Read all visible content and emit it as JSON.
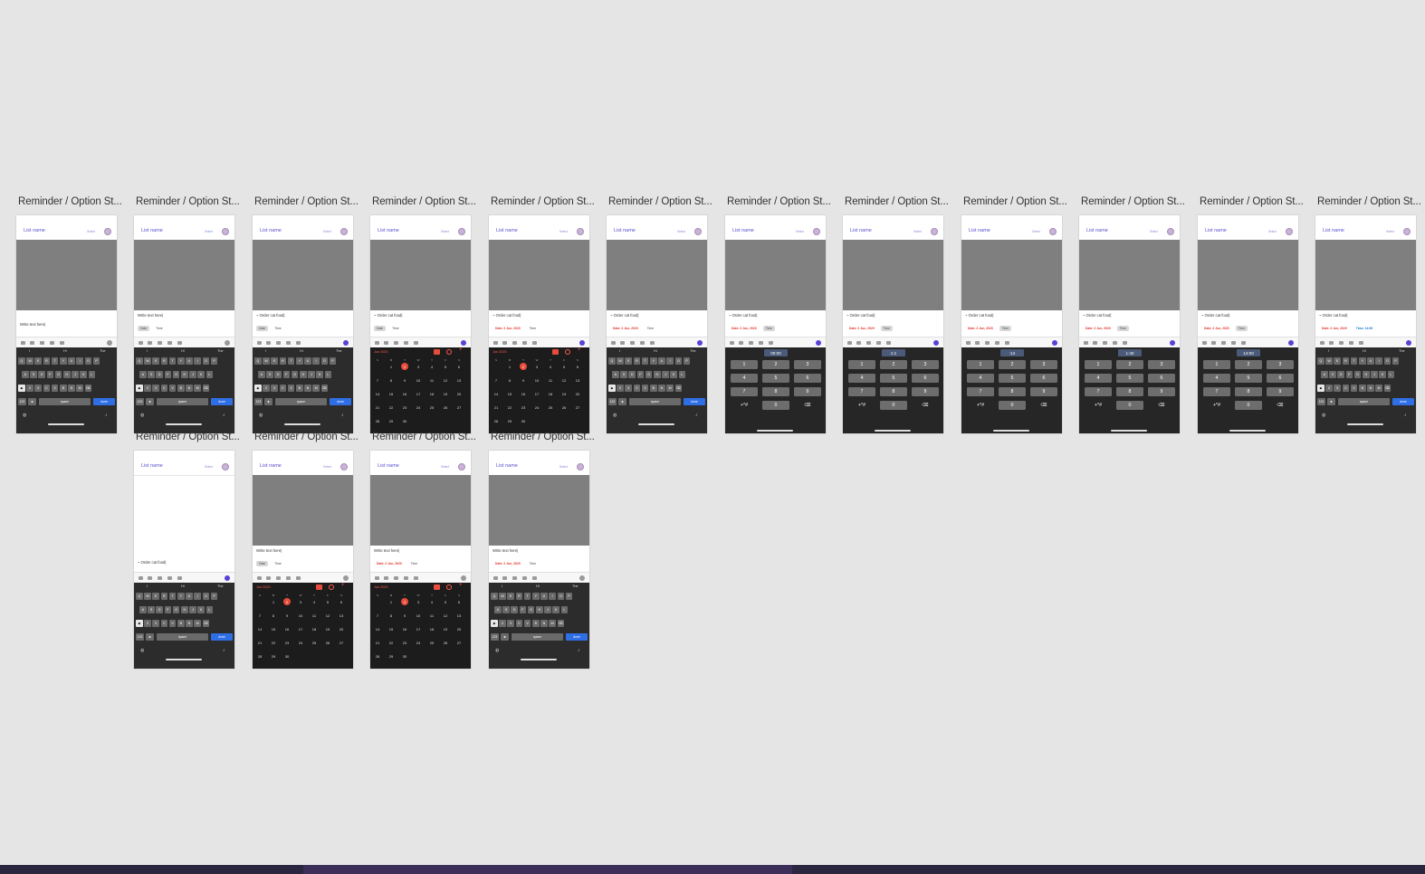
{
  "frames": [
    {
      "title": "Reminder / Option St...",
      "list_name": "List name",
      "select": "Select",
      "task": "Write text here|",
      "date": "",
      "time": "",
      "state": "keyboard",
      "row": 1
    },
    {
      "title": "Reminder / Option St...",
      "list_name": "List name",
      "select": "Select",
      "task": "Write text here|",
      "date": "Date",
      "time": "Time",
      "state": "keyboard",
      "row": 1
    },
    {
      "title": "Reminder / Option St...",
      "list_name": "List name",
      "select": "Select",
      "task": "~ Order cat food|",
      "date": "Date",
      "time": "Time",
      "state": "keyboard",
      "row": 1
    },
    {
      "title": "Reminder / Option St...",
      "list_name": "List name",
      "select": "Select",
      "task": "~ Order cat food|",
      "date": "Date",
      "time": "Time",
      "state": "calendar",
      "row": 1
    },
    {
      "title": "Reminder / Option St...",
      "list_name": "List name",
      "select": "Select",
      "task": "~ Order cat food|",
      "date": "Date: 2 Jun, 2020",
      "time": "Time",
      "state": "calendar",
      "row": 1
    },
    {
      "title": "Reminder / Option St...",
      "list_name": "List name",
      "select": "Select",
      "task": "~ Order cat food|",
      "date": "Date: 2 Jun, 2020",
      "time": "Time",
      "state": "keyboard",
      "row": 1
    },
    {
      "title": "Reminder / Option St...",
      "list_name": "List name",
      "select": "Select",
      "task": "~ Order cat food|",
      "date": "Date: 2 Jun, 2020",
      "time": "Time",
      "state": "numpad",
      "display": "00:00",
      "row": 1
    },
    {
      "title": "Reminder / Option St...",
      "list_name": "List name",
      "select": "Select",
      "task": "~ Order cat food|",
      "date": "Date: 2 Jun, 2020",
      "time": "Time",
      "state": "numpad",
      "display": "1:1",
      "row": 1
    },
    {
      "title": "Reminder / Option St...",
      "list_name": "List name",
      "select": "Select",
      "task": "~ Order cat food|",
      "date": "Date: 2 Jun, 2020",
      "time": "Time",
      "state": "numpad",
      "display": ":14",
      "row": 1
    },
    {
      "title": "Reminder / Option St...",
      "list_name": "List name",
      "select": "Select",
      "task": "~ Order cat food|",
      "date": "Date: 2 Jun, 2020",
      "time": "Time",
      "state": "numpad",
      "display": "1:40",
      "row": 1
    },
    {
      "title": "Reminder / Option St...",
      "list_name": "List name",
      "select": "Select",
      "task": "~ Order cat food|",
      "date": "Date: 2 Jun, 2020",
      "time": "Time",
      "state": "numpad",
      "display": "14:00",
      "row": 1
    },
    {
      "title": "Reminder / Option St...",
      "list_name": "List name",
      "select": "Select",
      "task": "~ Order cat food|",
      "date": "Date: 2 Jun, 2020",
      "time": "Time: 14:00",
      "state": "keyboard",
      "row": 1
    },
    {
      "title": "Reminder / Option St...",
      "list_name": "List name",
      "select": "Select",
      "task": "~ Order cat food|",
      "date": "",
      "time": "",
      "state": "keyboard",
      "row": 2
    },
    {
      "title": "Reminder / Option St...",
      "list_name": "List name",
      "select": "Select",
      "task": "Write text here|",
      "date": "Date",
      "time": "Time",
      "state": "calendar",
      "row": 2
    },
    {
      "title": "Reminder / Option St...",
      "list_name": "List name",
      "select": "Select",
      "task": "Write text here|",
      "date": "Date: 2 Jun, 2020",
      "time": "Time",
      "state": "calendar",
      "row": 2
    },
    {
      "title": "Reminder / Option St...",
      "list_name": "List name",
      "select": "Select",
      "task": "Write text here|",
      "date": "Date: 2 Jun, 2020",
      "time": "Time",
      "state": "keyboard",
      "row": 2
    }
  ],
  "keyboard": {
    "suggestions": [
      "I",
      "Hi",
      "The"
    ],
    "row1": [
      "Q",
      "W",
      "E",
      "R",
      "T",
      "Y",
      "U",
      "I",
      "O",
      "P"
    ],
    "row2": [
      "A",
      "S",
      "D",
      "F",
      "G",
      "H",
      "J",
      "K",
      "L"
    ],
    "row3": [
      "Z",
      "X",
      "C",
      "V",
      "B",
      "N",
      "M"
    ],
    "space": "space",
    "done": "done",
    "numbers": "123"
  },
  "calendar": {
    "month": "Jun 2020",
    "weekdays": [
      "S",
      "M",
      "T",
      "W",
      "T",
      "F",
      "S"
    ],
    "weeks": [
      [
        "",
        "1",
        "2",
        "3",
        "4",
        "5",
        "6"
      ],
      [
        "7",
        "8",
        "9",
        "10",
        "11",
        "12",
        "13"
      ],
      [
        "14",
        "15",
        "16",
        "17",
        "18",
        "19",
        "20"
      ],
      [
        "21",
        "22",
        "23",
        "24",
        "25",
        "26",
        "27"
      ],
      [
        "28",
        "29",
        "30",
        "",
        "",
        "",
        ""
      ]
    ],
    "selected": "2"
  },
  "numpad": {
    "keys": [
      "1",
      "2",
      "3",
      "4",
      "5",
      "6",
      "7",
      "8",
      "9",
      "+*#",
      "0",
      "⌫"
    ]
  },
  "colors": {
    "accent": "#5b3fd6",
    "date_red": "#e0342b",
    "time_blue": "#1976d2",
    "keyboard_bg": "#2c2c2c",
    "canvas_bg": "#e5e5e5"
  }
}
